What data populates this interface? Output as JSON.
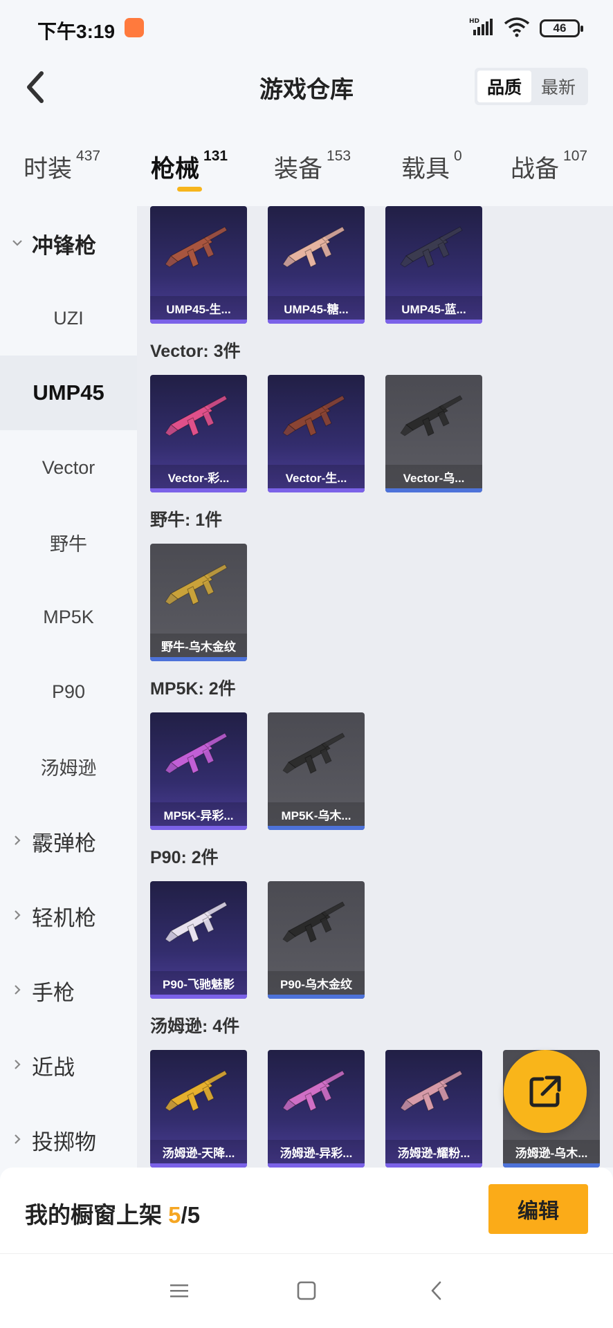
{
  "status_bar": {
    "time": "下午3:19",
    "battery": "46",
    "network": "HD"
  },
  "header": {
    "title": "游戏仓库",
    "sort_options": [
      "品质",
      "最新"
    ],
    "active_sort": "品质"
  },
  "category_tabs": [
    {
      "label": "时装",
      "count": "437"
    },
    {
      "label": "枪械",
      "count": "131",
      "active": true
    },
    {
      "label": "装备",
      "count": "153"
    },
    {
      "label": "载具",
      "count": "0"
    },
    {
      "label": "战备",
      "count": "107"
    }
  ],
  "sidebar": {
    "items": [
      {
        "label": "冲锋枪",
        "type": "group",
        "expanded": true
      },
      {
        "label": "UZI",
        "type": "sub"
      },
      {
        "label": "UMP45",
        "type": "sub",
        "active": true
      },
      {
        "label": "Vector",
        "type": "sub"
      },
      {
        "label": "野牛",
        "type": "sub"
      },
      {
        "label": "MP5K",
        "type": "sub"
      },
      {
        "label": "P90",
        "type": "sub"
      },
      {
        "label": "汤姆逊",
        "type": "sub"
      },
      {
        "label": "霰弹枪",
        "type": "group"
      },
      {
        "label": "轻机枪",
        "type": "group"
      },
      {
        "label": "手枪",
        "type": "group"
      },
      {
        "label": "近战",
        "type": "group"
      },
      {
        "label": "投掷物",
        "type": "group"
      }
    ]
  },
  "sections": [
    {
      "title": "",
      "items": [
        {
          "name": "UMP45-生...",
          "tier": "purple",
          "gun_color": "#a8553f"
        },
        {
          "name": "UMP45-糖...",
          "tier": "purple",
          "gun_color": "#e6b3a0"
        },
        {
          "name": "UMP45-蓝...",
          "tier": "purple",
          "gun_color": "#3b3b4f"
        }
      ]
    },
    {
      "title": "Vector: 3件",
      "items": [
        {
          "name": "Vector-彩...",
          "tier": "purple",
          "gun_color": "#e0508a"
        },
        {
          "name": "Vector-生...",
          "tier": "purple",
          "gun_color": "#8b4433"
        },
        {
          "name": "Vector-乌...",
          "tier": "grey",
          "gun_color": "#2b2b2b"
        }
      ]
    },
    {
      "title": "野牛: 1件",
      "items": [
        {
          "name": "野牛-乌木金纹",
          "tier": "grey",
          "gun_color": "#c9a23a"
        }
      ]
    },
    {
      "title": "MP5K: 2件",
      "items": [
        {
          "name": "MP5K-异彩...",
          "tier": "purple",
          "gun_color": "#c25fd6"
        },
        {
          "name": "MP5K-乌木...",
          "tier": "grey",
          "gun_color": "#2d2d2d"
        }
      ]
    },
    {
      "title": "P90: 2件",
      "items": [
        {
          "name": "P90-飞驰魅影",
          "tier": "purple",
          "gun_color": "#e8e2ef"
        },
        {
          "name": "P90-乌木金纹",
          "tier": "grey",
          "gun_color": "#2a2a2a"
        }
      ]
    },
    {
      "title": "汤姆逊: 4件",
      "items": [
        {
          "name": "汤姆逊-天降...",
          "tier": "purple",
          "gun_color": "#e6b02e"
        },
        {
          "name": "汤姆逊-异彩...",
          "tier": "purple",
          "gun_color": "#d06fc6"
        },
        {
          "name": "汤姆逊-耀粉...",
          "tier": "purple",
          "gun_color": "#d69aa8"
        },
        {
          "name": "汤姆逊-乌木...",
          "tier": "grey",
          "gun_color": "#2b2b2b"
        }
      ]
    }
  ],
  "bottom": {
    "label": "我的橱窗上架",
    "current": "5",
    "separator": "/",
    "max": "5",
    "edit_label": "编辑"
  }
}
